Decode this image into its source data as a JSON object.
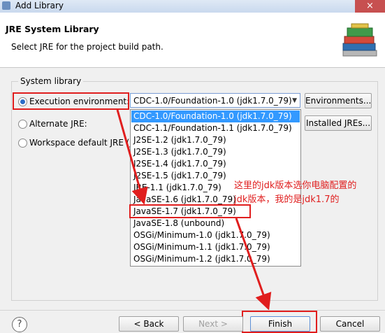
{
  "window": {
    "title": "Add Library",
    "close": "×"
  },
  "banner": {
    "title": "JRE System Library",
    "description": "Select JRE for the project build path."
  },
  "group": {
    "legend": "System library",
    "execution_label": "Execution environment:",
    "alternate_label": "Alternate JRE:",
    "workspace_label": "Workspace default JRE (j"
  },
  "combo": {
    "selected": "CDC-1.0/Foundation-1.0 (jdk1.7.0_79)",
    "arrow": "▼"
  },
  "buttons": {
    "environments": "Environments...",
    "installed_jres": "Installed JREs...",
    "back": "< Back",
    "next": "Next >",
    "finish": "Finish",
    "cancel": "Cancel",
    "help": "?"
  },
  "options": [
    "CDC-1.0/Foundation-1.0 (jdk1.7.0_79)",
    "CDC-1.1/Foundation-1.1 (jdk1.7.0_79)",
    "J2SE-1.2 (jdk1.7.0_79)",
    "J2SE-1.3 (jdk1.7.0_79)",
    "J2SE-1.4 (jdk1.7.0_79)",
    "J2SE-1.5 (jdk1.7.0_79)",
    "JRE-1.1 (jdk1.7.0_79)",
    "JavaSE-1.6 (jdk1.7.0_79)",
    "JavaSE-1.7 (jdk1.7.0_79)",
    "JavaSE-1.8 (unbound)",
    "OSGi/Minimum-1.0 (jdk1.7.0_79)",
    "OSGi/Minimum-1.1 (jdk1.7.0_79)",
    "OSGi/Minimum-1.2 (jdk1.7.0_79)"
  ],
  "annotation": {
    "line1": "这里的jdk版本选你电脑配置的",
    "line2": "jdk版本，我的是jdk1.7的",
    "color": "#e01e1e"
  },
  "icons": {
    "app": "eclipse-app-icon",
    "banner": "library-books-icon",
    "help": "help-icon"
  }
}
